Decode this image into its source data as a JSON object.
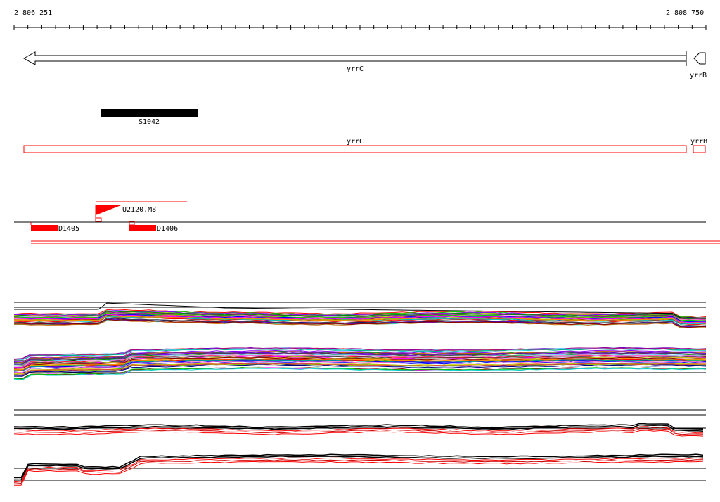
{
  "ruler": {
    "start_label": "2 806 251",
    "end_label": "2 808 750",
    "start": 2806251,
    "end": 2808750
  },
  "colors": {
    "black": "#000000",
    "red": "#ff0000",
    "dark_red": "#cc0000"
  },
  "genes": [
    {
      "name": "yrrC",
      "strand": "-",
      "start": 2806283,
      "end": 2808673
    },
    {
      "name": "yrrB",
      "strand": "-",
      "start": 2808697,
      "end": 2808746
    }
  ],
  "segment": {
    "name": "S1042",
    "start": 2806568,
    "end": 2806917
  },
  "annotations": [
    {
      "name": "yrrC",
      "start": 2806283,
      "end": 2808673
    },
    {
      "name": "yrrB",
      "start": 2808697,
      "end": 2808740
    }
  ],
  "features": {
    "upstream": {
      "name": "U2120.M8"
    },
    "downstream": [
      {
        "name": "D1405"
      },
      {
        "name": "D1406"
      }
    ]
  }
}
